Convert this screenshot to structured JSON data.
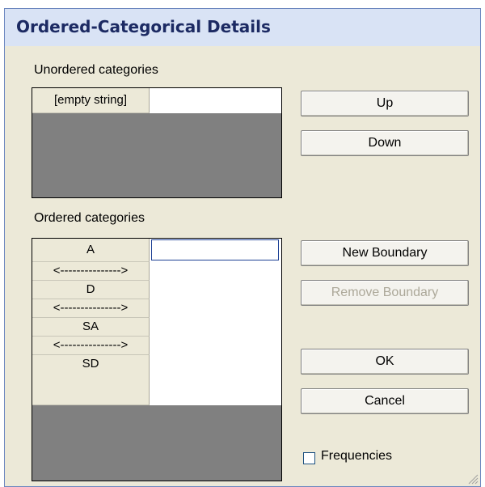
{
  "window": {
    "title": "Ordered-Categorical Details"
  },
  "unordered": {
    "label": "Unordered categories",
    "rows": [
      "[empty string]"
    ]
  },
  "ordered": {
    "label": "Ordered categories",
    "rows": [
      "A",
      "<--------------->",
      "D",
      "<--------------->",
      "SA",
      "<--------------->",
      "SD"
    ]
  },
  "buttons": {
    "up": "Up",
    "down": "Down",
    "new_boundary": "New Boundary",
    "remove_boundary": "Remove Boundary",
    "ok": "OK",
    "cancel": "Cancel"
  },
  "frequencies": {
    "label": "Frequencies",
    "checked": false
  }
}
